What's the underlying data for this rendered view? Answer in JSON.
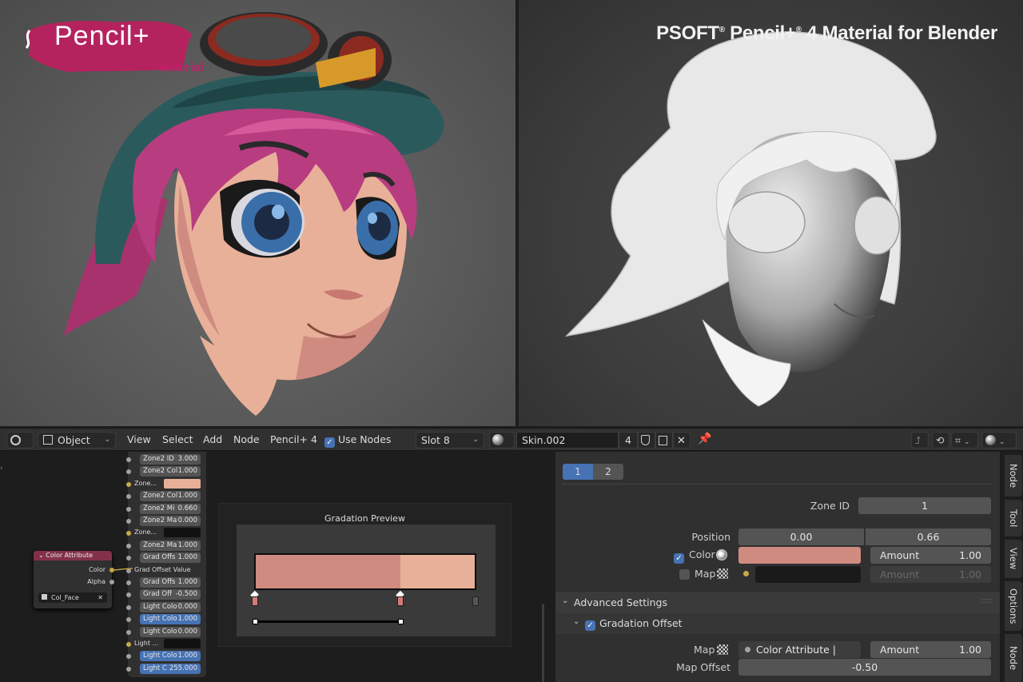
{
  "brand": {
    "logo_text": "Pencil+",
    "logo_sub": "Material",
    "title_a": "PSOFT",
    "title_reg": "®",
    "title_b": " Pencil+",
    "title_reg2": "®",
    "title_c": " 4 Material for Blender"
  },
  "header": {
    "object_mode": "Object",
    "menus": [
      "View",
      "Select",
      "Add",
      "Node",
      "Pencil+ 4"
    ],
    "use_nodes_label": "Use Nodes",
    "slot": "Slot 8",
    "material_name": "Skin.002",
    "user_count": "4"
  },
  "node_list": [
    {
      "label": "Zone2 ID",
      "value": "3.000",
      "type": "field"
    },
    {
      "label": "Zone2 Col",
      "value": "1.000",
      "type": "field"
    },
    {
      "label": "Zone...",
      "value": "",
      "type": "color",
      "color": "#e8b098"
    },
    {
      "label": "Zone2 Col",
      "value": "1.000",
      "type": "field"
    },
    {
      "label": "Zone2 Mi",
      "value": "0.660",
      "type": "field"
    },
    {
      "label": "Zone2 Ma",
      "value": "0.000",
      "type": "field"
    },
    {
      "label": "Zone...",
      "value": "",
      "type": "color",
      "color": "#111111"
    },
    {
      "label": "Zone2 Ma",
      "value": "1.000",
      "type": "field"
    },
    {
      "label": "Grad Offs",
      "value": "1.000",
      "type": "field"
    },
    {
      "label": "Grad Offset Value",
      "value": "",
      "type": "label"
    },
    {
      "label": "Grad Offs",
      "value": "1.000",
      "type": "field"
    },
    {
      "label": "Grad Off",
      "value": "-0.500",
      "type": "field"
    },
    {
      "label": "Light Colo",
      "value": "0.000",
      "type": "field"
    },
    {
      "label": "Light Colo",
      "value": "1.000",
      "type": "blue"
    },
    {
      "label": "Light Colo",
      "value": "0.000",
      "type": "field"
    },
    {
      "label": "Light ...",
      "value": "",
      "type": "color",
      "color": "#111111"
    },
    {
      "label": "Light Colo",
      "value": "1.000",
      "type": "blue"
    },
    {
      "label": "Light C",
      "value": "255.000",
      "type": "blue"
    }
  ],
  "color_attribute_node": {
    "title": "Color Attribute",
    "out_color": "Color",
    "out_alpha": "Alpha",
    "attribute": "Col_Face"
  },
  "gradation_preview": {
    "title": "Gradation Preview",
    "zone_colors": [
      "#cf8b80",
      "#e8b098"
    ],
    "zone_split": 0.66
  },
  "props": {
    "tabs": [
      "1",
      "2"
    ],
    "zone_id_label": "Zone ID",
    "zone_id_value": "1",
    "position_label": "Position",
    "position_values": [
      "0.00",
      "0.66"
    ],
    "color_label": "Color",
    "color_swatch": "#cf8b80",
    "amount_label": "Amount",
    "color_amount": "1.00",
    "map_label": "Map",
    "map_amount": "1.00",
    "advanced_label": "Advanced Settings",
    "grad_offset_label": "Gradation Offset",
    "go_map_label": "Map",
    "go_map_value": "Color Attribute | Color",
    "go_amount": "1.00",
    "map_offset_label": "Map Offset",
    "map_offset_value": "-0.50"
  },
  "side_tabs": [
    "Node",
    "Tool",
    "View",
    "Options",
    "Node Wrangler"
  ]
}
